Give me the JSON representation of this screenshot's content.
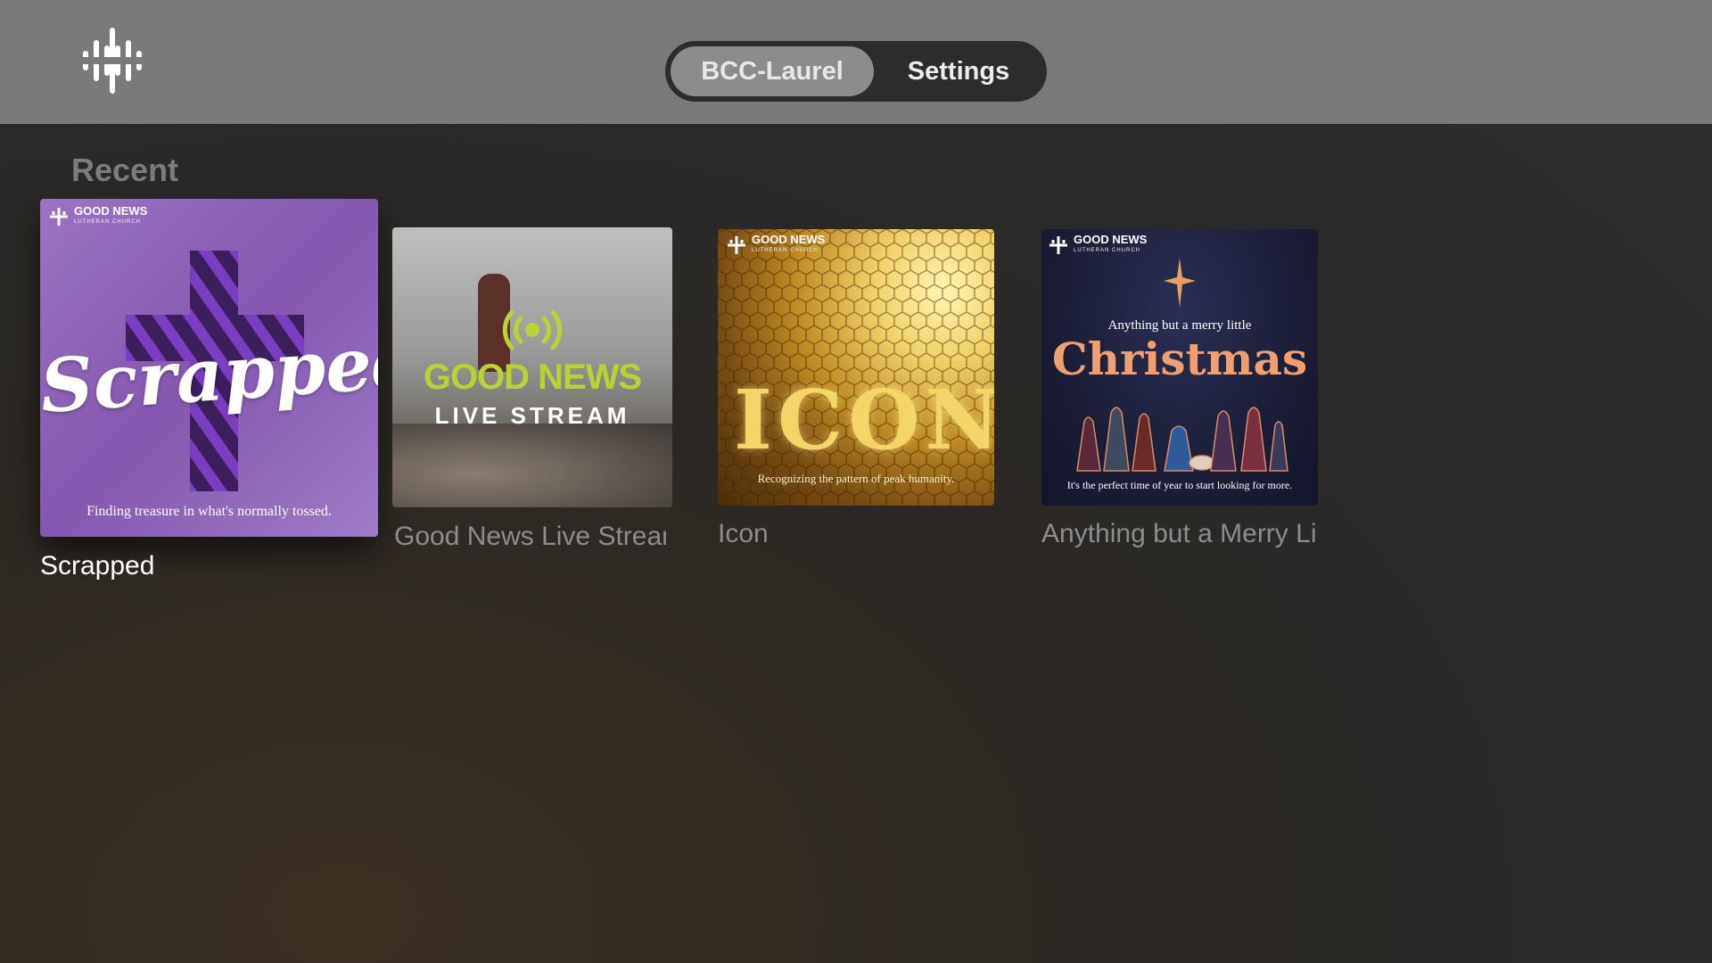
{
  "header": {
    "logo": "waveform-cross-icon",
    "tabs": [
      {
        "label": "BCC-Laurel",
        "active": true
      },
      {
        "label": "Settings",
        "active": false
      }
    ]
  },
  "section": {
    "title": "Recent"
  },
  "cards": [
    {
      "title": "Scrapped",
      "focused": true,
      "art": {
        "brand": "GOOD NEWS",
        "brand_sub": "LUTHERAN CHURCH",
        "headline": "Scrapped",
        "caption": "Finding treasure in what's normally tossed.",
        "bg_color": "#8b63b5"
      }
    },
    {
      "title": "Good News Live Stream",
      "focused": false,
      "art": {
        "headline_1": "GOOD NEWS",
        "headline_2": "LIVE STREAM",
        "accent_color": "#b9d432"
      }
    },
    {
      "title": "Icon",
      "focused": false,
      "art": {
        "brand": "GOOD NEWS",
        "brand_sub": "LUTHERAN CHURCH",
        "headline": "ICON",
        "caption": "Recognizing the pattern of peak humanity.",
        "accent_color": "#d9a62a"
      }
    },
    {
      "title": "Anything but a Merry Little Christmas",
      "focused": false,
      "art": {
        "brand": "GOOD NEWS",
        "brand_sub": "LUTHERAN CHURCH",
        "kicker": "Anything but a merry little",
        "headline": "Christmas",
        "caption": "It's the perfect time of year to start looking for more.",
        "bg_color": "#1b1e36"
      }
    }
  ]
}
